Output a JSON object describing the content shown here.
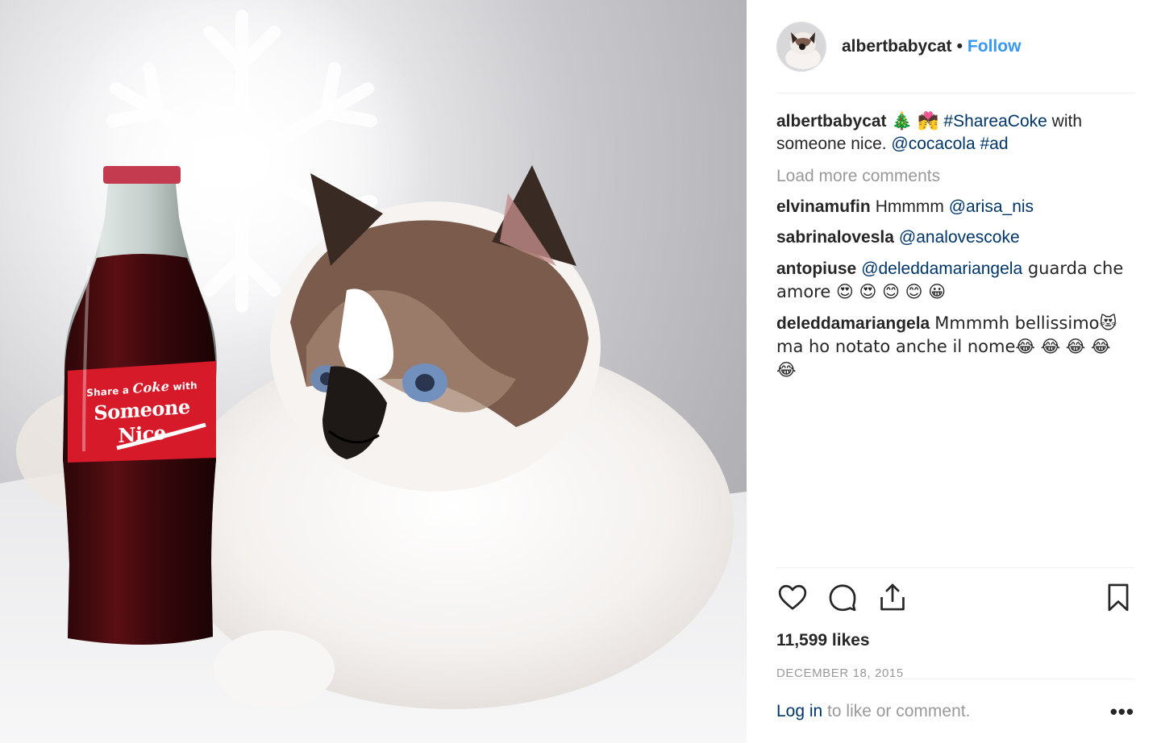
{
  "header": {
    "username": "albertbabycat",
    "separator": "•",
    "follow_label": "Follow"
  },
  "photo": {
    "label_small_prefix": "Share a",
    "label_small_brand": "Coke",
    "label_small_suffix": "with",
    "label_line1": "Someone",
    "label_line2": "Nice"
  },
  "caption": {
    "author": "albertbabycat",
    "emojis": "🎄 💏",
    "hashtag1": "#ShareaCoke",
    "text1": " with someone nice. ",
    "mention": "@cocacola",
    "hashtag2": "#ad"
  },
  "load_more_label": "Load more comments",
  "comments": [
    {
      "author": "elvinamufin",
      "text": "Hmmmm ",
      "mention": "@arisa_nis",
      "tail": ""
    },
    {
      "author": "sabrinalovesla",
      "text": "",
      "mention": "@analovescoke",
      "tail": ""
    },
    {
      "author": "antopiuse",
      "text": "",
      "mention": "@deleddamariangela",
      "tail": " guarda che amore 😍 😍 😊 😊 😀"
    },
    {
      "author": "deleddamariangela",
      "text": "Mmmmh bellissimo😻 ma ho notato anche il nome😂 😂 😂 😂 😂",
      "mention": "",
      "tail": ""
    }
  ],
  "likes": "11,599 likes",
  "date": "DECEMBER 18, 2015",
  "footer": {
    "login_label": "Log in",
    "login_suffix": " to like or comment.",
    "more_label": "•••"
  },
  "colors": {
    "accent_blue": "#3897f0",
    "link_navy": "#003569",
    "muted_gray": "#999999",
    "text_dark": "#262626",
    "coke_red": "#d71a2a"
  },
  "icons": [
    "heart-icon",
    "comment-icon",
    "share-icon",
    "bookmark-icon",
    "more-options-icon"
  ]
}
